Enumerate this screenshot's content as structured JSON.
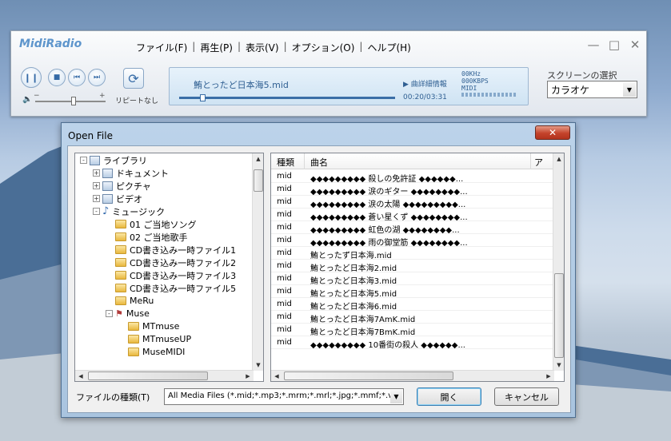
{
  "player": {
    "logo": "MidiRadio",
    "menu": [
      "ファイル(F)",
      "再生(P)",
      "表示(V)",
      "オプション(O)",
      "ヘルプ(H)"
    ],
    "repeat_label": "リピートなし",
    "now_playing": "鮪とったど日本海5.mid",
    "detail_label": "曲詳細情報",
    "info": [
      "00KHz",
      "000KBPS",
      "MIDI"
    ],
    "time": "00:20/03:31",
    "screen_label": "スクリーンの選択",
    "screen_value": "カラオケ",
    "volume_fraction": 0.55,
    "seek_fraction": 0.095
  },
  "dialog": {
    "title": "Open File",
    "tree": [
      {
        "label": "ライブラリ",
        "level": 0,
        "icon": "library-icon",
        "exp": "-"
      },
      {
        "label": "ドキュメント",
        "level": 1,
        "icon": "documents-icon",
        "exp": "+"
      },
      {
        "label": "ピクチャ",
        "level": 1,
        "icon": "pictures-icon",
        "exp": "+"
      },
      {
        "label": "ビデオ",
        "level": 1,
        "icon": "videos-icon",
        "exp": "+"
      },
      {
        "label": "ミュージック",
        "level": 1,
        "icon": "music-icon",
        "exp": "-"
      },
      {
        "label": "01 ご当地ソング",
        "level": 2,
        "icon": "folder-icon",
        "exp": ""
      },
      {
        "label": "02 ご当地歌手",
        "level": 2,
        "icon": "folder-icon",
        "exp": ""
      },
      {
        "label": "CD書き込み一時ファイル1",
        "level": 2,
        "icon": "folder-icon",
        "exp": ""
      },
      {
        "label": "CD書き込み一時ファイル2",
        "level": 2,
        "icon": "folder-icon",
        "exp": ""
      },
      {
        "label": "CD書き込み一時ファイル3",
        "level": 2,
        "icon": "folder-icon",
        "exp": ""
      },
      {
        "label": "CD書き込み一時ファイル5",
        "level": 2,
        "icon": "folder-icon",
        "exp": ""
      },
      {
        "label": "MeRu",
        "level": 2,
        "icon": "folder-icon",
        "exp": ""
      },
      {
        "label": "Muse",
        "level": 2,
        "icon": "muse-icon",
        "exp": "-"
      },
      {
        "label": "MTmuse",
        "level": 3,
        "icon": "folder-icon",
        "exp": ""
      },
      {
        "label": "MTmuseUP",
        "level": 3,
        "icon": "folder-icon",
        "exp": ""
      },
      {
        "label": "MuseMIDI",
        "level": 3,
        "icon": "folder-icon",
        "exp": ""
      }
    ],
    "columns": [
      "種類",
      "曲名",
      "ア"
    ],
    "files": [
      {
        "type": "mid",
        "name": "◆◆◆◆◆◆◆◆◆ 殺しの免許証 ◆◆◆◆◆◆..."
      },
      {
        "type": "mid",
        "name": "◆◆◆◆◆◆◆◆◆ 涙のギター ◆◆◆◆◆◆◆◆..."
      },
      {
        "type": "mid",
        "name": "◆◆◆◆◆◆◆◆◆ 涙の太陽 ◆◆◆◆◆◆◆◆◆..."
      },
      {
        "type": "mid",
        "name": "◆◆◆◆◆◆◆◆◆ 蒼い星くず ◆◆◆◆◆◆◆◆..."
      },
      {
        "type": "mid",
        "name": "◆◆◆◆◆◆◆◆◆ 虹色の湖 ◆◆◆◆◆◆◆◆..."
      },
      {
        "type": "mid",
        "name": "◆◆◆◆◆◆◆◆◆ 雨の御堂筋 ◆◆◆◆◆◆◆◆..."
      },
      {
        "type": "mid",
        "name": "鮪とったず日本海.mid"
      },
      {
        "type": "mid",
        "name": "鮪とったど日本海2.mid"
      },
      {
        "type": "mid",
        "name": "鮪とったど日本海3.mid"
      },
      {
        "type": "mid",
        "name": "鮪とったど日本海5.mid"
      },
      {
        "type": "mid",
        "name": "鮪とったど日本海6.mid"
      },
      {
        "type": "mid",
        "name": "鮪とったど日本海7AmK.mid"
      },
      {
        "type": "mid",
        "name": "鮪とったど日本海7BmK.mid"
      },
      {
        "type": "mid",
        "name": "◆◆◆◆◆◆◆◆◆ 10番街の殺人 ◆◆◆◆◆◆..."
      }
    ],
    "file_type_label": "ファイルの種類(T)",
    "file_type_value": "All Media Files (*.mid;*.mp3;*.mrm;*.mrl;*.jpg;*.mmf;*.vc",
    "open_label": "開く",
    "cancel_label": "キャンセル"
  }
}
